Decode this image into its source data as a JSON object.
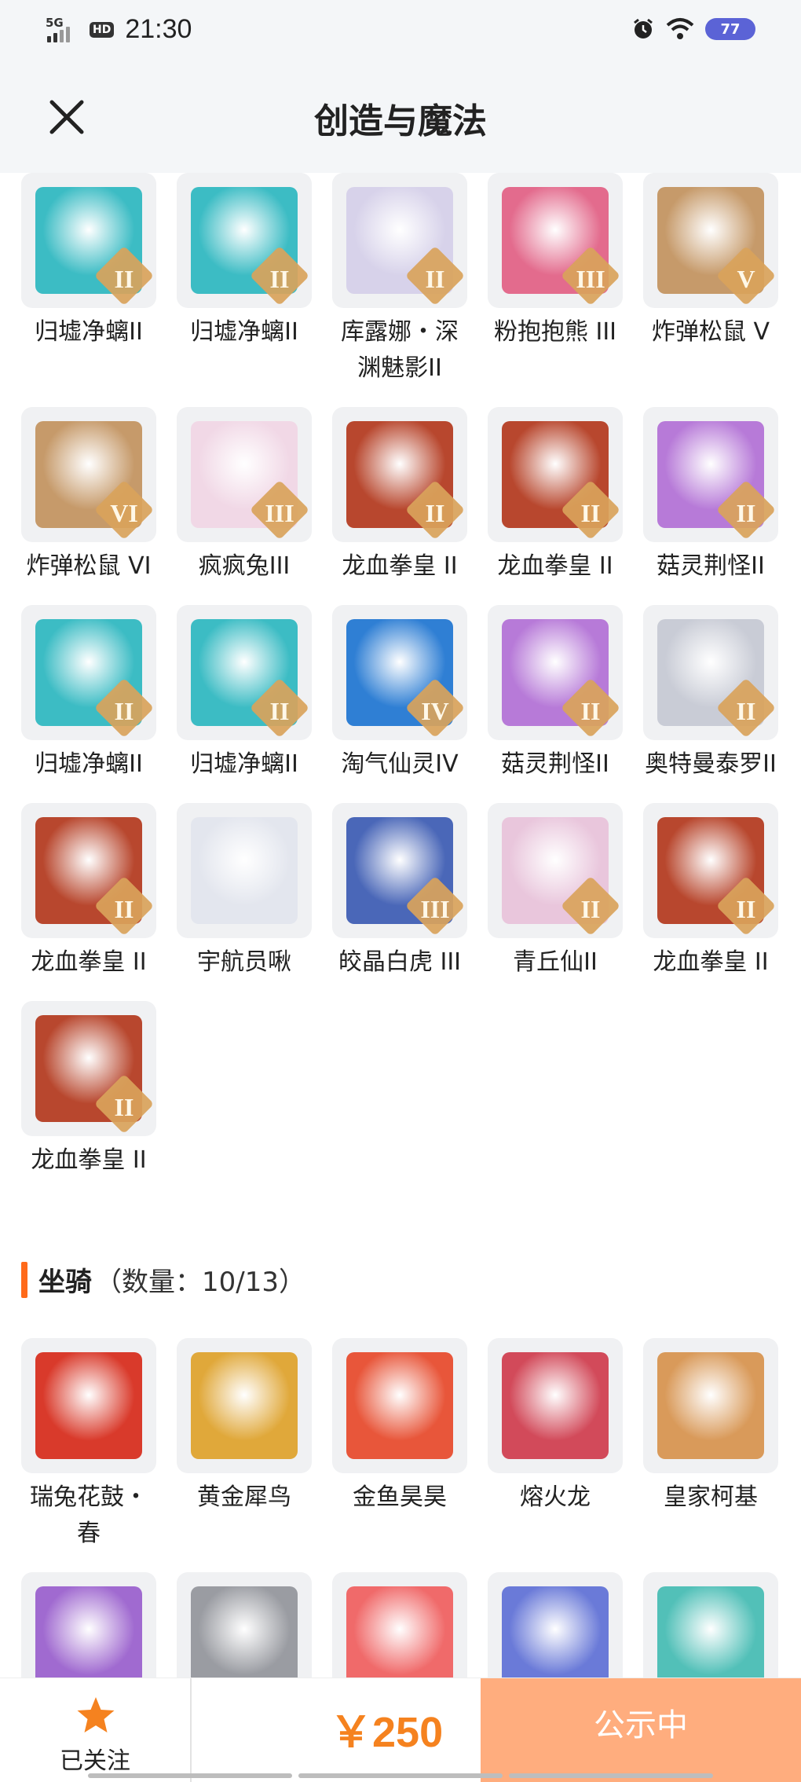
{
  "status_bar": {
    "network": "5G",
    "hd": "HD",
    "time": "21:30",
    "battery": "77"
  },
  "header": {
    "title": "创造与魔法"
  },
  "characters": [
    {
      "label": "归墟净螭II",
      "grade": "II",
      "color": "#3cbcc4"
    },
    {
      "label": "归墟净螭II",
      "grade": "II",
      "color": "#3cbcc4"
    },
    {
      "label": "库露娜・深渊魅影II",
      "grade": "II",
      "color": "#d7d2ea"
    },
    {
      "label": "粉抱抱熊 III",
      "grade": "III",
      "color": "#e36b8d"
    },
    {
      "label": "炸弹松鼠 V",
      "grade": "V",
      "color": "#c69a6a"
    },
    {
      "label": "炸弹松鼠 VI",
      "grade": "VI",
      "color": "#c69a6a"
    },
    {
      "label": "疯疯兔III",
      "grade": "III",
      "color": "#f1d8e6"
    },
    {
      "label": "龙血拳皇 II",
      "grade": "II",
      "color": "#b8472e"
    },
    {
      "label": "龙血拳皇 II",
      "grade": "II",
      "color": "#b8472e"
    },
    {
      "label": "菇灵荆怪II",
      "grade": "II",
      "color": "#b77ad8"
    },
    {
      "label": "归墟净螭II",
      "grade": "II",
      "color": "#3cbcc4"
    },
    {
      "label": "归墟净螭II",
      "grade": "II",
      "color": "#3cbcc4"
    },
    {
      "label": "淘气仙灵IV",
      "grade": "IV",
      "color": "#2f7fd4"
    },
    {
      "label": "菇灵荆怪II",
      "grade": "II",
      "color": "#b77ad8"
    },
    {
      "label": "奥特曼泰罗II",
      "grade": "II",
      "color": "#c9ccd6"
    },
    {
      "label": "龙血拳皇 II",
      "grade": "II",
      "color": "#b8472e"
    },
    {
      "label": "宇航员啾",
      "grade": "",
      "color": "#e3e6ee"
    },
    {
      "label": "皎晶白虎 III",
      "grade": "III",
      "color": "#4a67b8"
    },
    {
      "label": "青丘仙II",
      "grade": "II",
      "color": "#e9c6dc"
    },
    {
      "label": "龙血拳皇 II",
      "grade": "II",
      "color": "#b8472e"
    },
    {
      "label": "龙血拳皇 II",
      "grade": "II",
      "color": "#b8472e"
    }
  ],
  "mounts_section": {
    "title": "坐骑",
    "count": "（数量：10/13）"
  },
  "mounts": [
    {
      "label": "瑞兔花鼓・春",
      "color": "#d93a2b"
    },
    {
      "label": "黄金犀鸟",
      "color": "#e0a83a"
    },
    {
      "label": "金鱼昊昊",
      "color": "#e8563a"
    },
    {
      "label": "熔火龙",
      "color": "#d24a5a"
    },
    {
      "label": "皇家柯基",
      "color": "#d99a5a"
    },
    {
      "label": "",
      "color": "#a06ad0"
    },
    {
      "label": "",
      "color": "#9a9ca2"
    },
    {
      "label": "",
      "color": "#f06a6a"
    },
    {
      "label": "",
      "color": "#6a7ad8"
    },
    {
      "label": "",
      "color": "#52c0b8"
    }
  ],
  "bottom_bar": {
    "follow_label": "已关注",
    "price": "￥250",
    "action_label": "公示中"
  },
  "colors": {
    "accent": "#ff6a1a",
    "price": "#f5821f",
    "action_bg": "#ffad7e",
    "star": "#f5821f"
  }
}
